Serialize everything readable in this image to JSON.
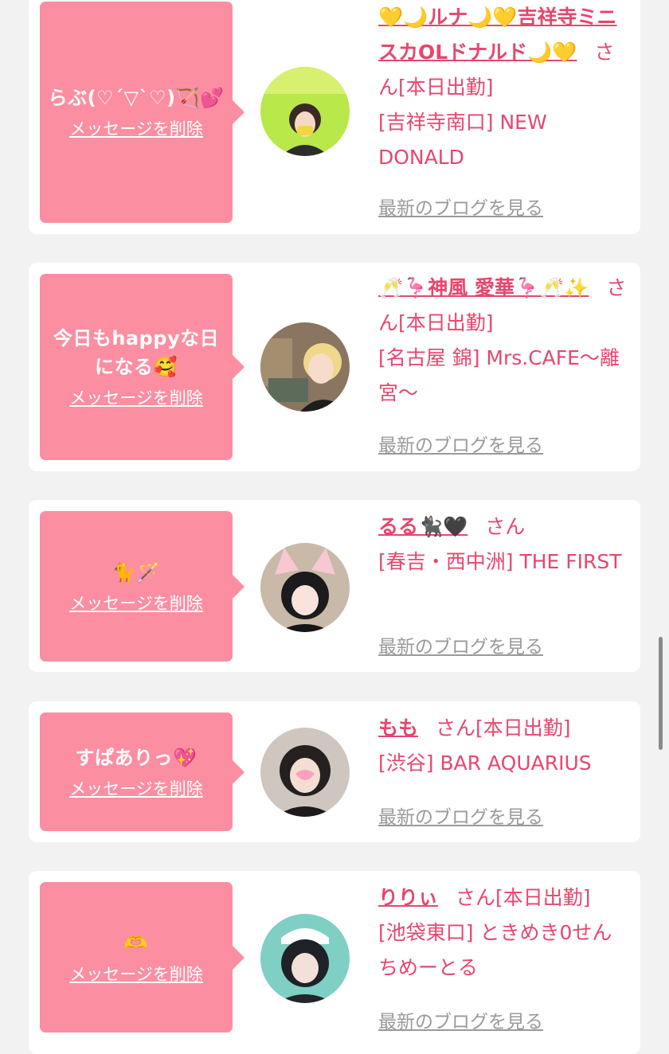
{
  "delete_label": "メッセージを削除",
  "blog_label": "最新のブログを見る",
  "suffix": "さん",
  "today_badge": "[本日出勤]",
  "colors": {
    "accent": "#e6476e",
    "bubble": "#fc8ea2",
    "link_gray": "#9a9a9a",
    "background": "#f2f2f2"
  },
  "cards": [
    {
      "message": "らぶ(♡´▽`♡)🏹💕",
      "name": "💛🌙ルナ🌙💛吉祥寺ミニスカOLドナルド🌙💛",
      "working_today": "[本日出勤]",
      "shop": "[吉祥寺南口] NEW DONALD",
      "avatar_icon": "avatar-donald"
    },
    {
      "message": "今日もhappyな日になる🥰",
      "name": "🥂🦩神風 愛華🦩🥂✨",
      "working_today": "[本日出勤]",
      "shop": "[名古屋 錦] Mrs.CAFE〜離宮〜",
      "avatar_icon": "avatar-aika"
    },
    {
      "message": "🐈🪄",
      "name": "るる🐈‍⬛🖤",
      "working_today": "",
      "shop": "[春吉・西中洲] THE FIRST",
      "avatar_icon": "avatar-ruru"
    },
    {
      "message": "すぱありっ💖",
      "name": "もも",
      "working_today": "[本日出勤]",
      "shop": "[渋谷] BAR AQUARIUS",
      "avatar_icon": "avatar-momo"
    },
    {
      "message": "🫶",
      "name": "りりぃ",
      "working_today": "[本日出勤]",
      "shop": "[池袋東口] ときめき0せんちめーとる",
      "avatar_icon": "avatar-ririi"
    }
  ]
}
